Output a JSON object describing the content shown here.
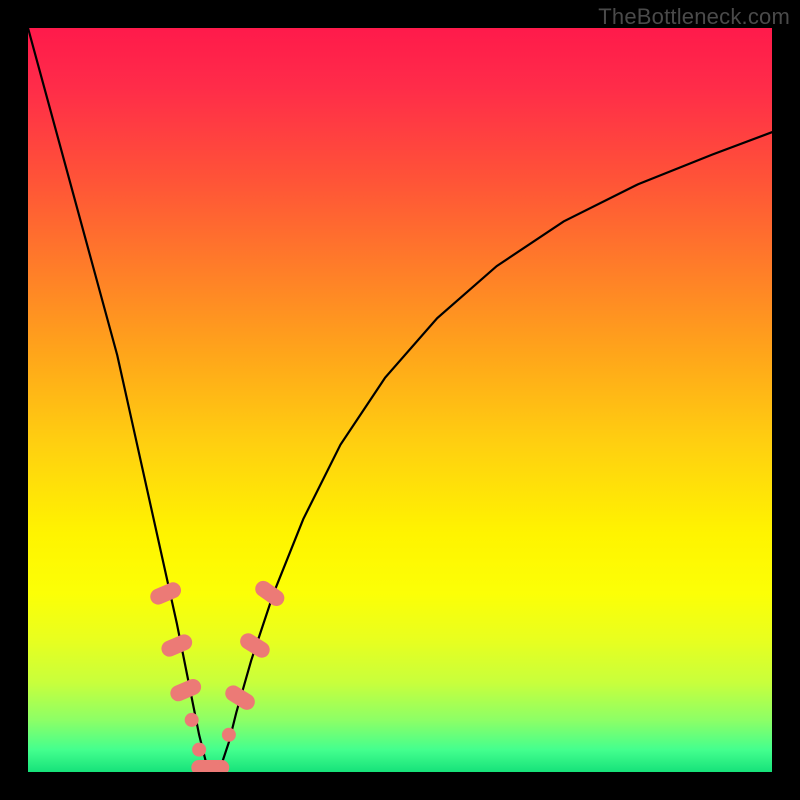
{
  "watermark": "TheBottleneck.com",
  "chart_data": {
    "type": "line",
    "title": "",
    "xlabel": "",
    "ylabel": "",
    "xlim": [
      0,
      100
    ],
    "ylim": [
      0,
      100
    ],
    "series": [
      {
        "name": "bottleneck-curve",
        "x": [
          0,
          3,
          6,
          9,
          12,
          14,
          16,
          18,
          20,
          21,
          22,
          23,
          24,
          25,
          26,
          27,
          28,
          30,
          33,
          37,
          42,
          48,
          55,
          63,
          72,
          82,
          92,
          100
        ],
        "values": [
          100,
          89,
          78,
          67,
          56,
          47,
          38,
          29,
          20,
          15,
          10,
          5,
          1,
          0,
          1,
          4,
          8,
          15,
          24,
          34,
          44,
          53,
          61,
          68,
          74,
          79,
          83,
          86
        ]
      }
    ],
    "markers": [
      {
        "x": 18.5,
        "y": 24,
        "shape": "pill",
        "angle": 67
      },
      {
        "x": 20.0,
        "y": 17,
        "shape": "pill",
        "angle": 67
      },
      {
        "x": 21.2,
        "y": 11,
        "shape": "pill",
        "angle": 67
      },
      {
        "x": 22.0,
        "y": 7,
        "shape": "dot",
        "angle": 0
      },
      {
        "x": 23.0,
        "y": 3,
        "shape": "dot",
        "angle": 0
      },
      {
        "x": 24.5,
        "y": 0.6,
        "shape": "wide-pill",
        "angle": 0
      },
      {
        "x": 27.0,
        "y": 5,
        "shape": "dot",
        "angle": 0
      },
      {
        "x": 28.5,
        "y": 10,
        "shape": "pill",
        "angle": -58
      },
      {
        "x": 30.5,
        "y": 17,
        "shape": "pill",
        "angle": -58
      },
      {
        "x": 32.5,
        "y": 24,
        "shape": "pill",
        "angle": -55
      }
    ],
    "gradient_stops_percent_to_color": [
      [
        0,
        "#ff1a4b"
      ],
      [
        20,
        "#ff5238"
      ],
      [
        44,
        "#ffa61a"
      ],
      [
        68,
        "#fff400"
      ],
      [
        88,
        "#c8ff3c"
      ],
      [
        100,
        "#16e27a"
      ]
    ],
    "notes": "V-shaped bottleneck curve on rainbow gradient background. Minimum (0%) near x≈25. Salmon-colored rounded markers cluster along both sides of the V near the bottom. Plot inset on black border; watermark top-right."
  },
  "colors": {
    "curve": "#000000",
    "marker": "#ec7a76",
    "watermark": "#4a4a4a",
    "border": "#000000"
  }
}
